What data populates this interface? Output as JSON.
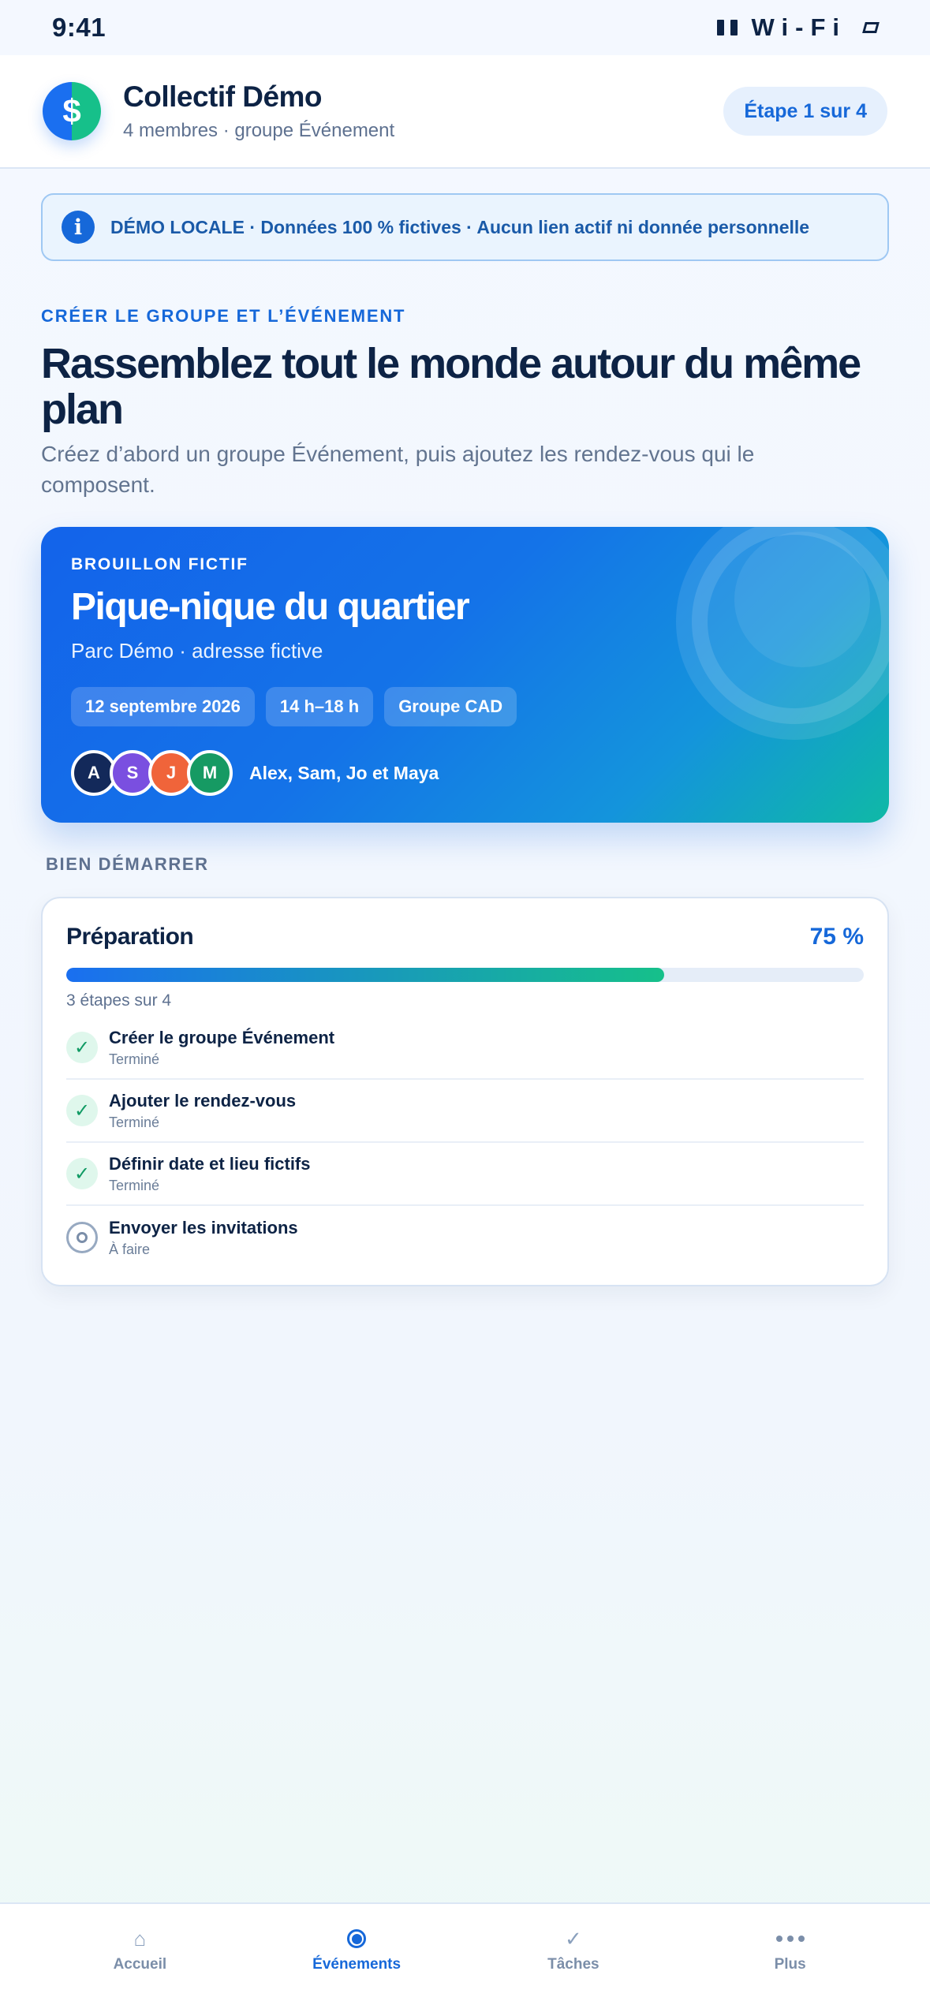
{
  "status_bar": {
    "time": "9:41",
    "network": "Wi-Fi",
    "signal_icon": "signal-bars-icon",
    "battery_icon": "battery-icon"
  },
  "header": {
    "logo_symbol": "$",
    "title": "Collectif Démo",
    "subtitle": "4 membres · groupe Événement",
    "step_label": "Étape 1 sur 4"
  },
  "banner": {
    "icon_symbol": "i",
    "text": "DÉMO LOCALE · Données 100 % fictives · Aucun lien actif ni donnée personnelle"
  },
  "intro": {
    "eyebrow": "CRÉER LE GROUPE ET L’ÉVÉNEMENT",
    "headline": "Rassemblez tout le monde autour du même plan",
    "description": "Créez d’abord un groupe Événement, puis ajoutez les rendez-vous qui le composent."
  },
  "event_card": {
    "eyebrow": "BROUILLON FICTIF",
    "title": "Pique-nique du quartier",
    "place": "Parc Démo · adresse fictive",
    "chips": [
      "12 septembre 2026",
      "14 h–18 h",
      "Groupe CAD"
    ],
    "avatars": [
      {
        "initial": "A",
        "color": "#13295a"
      },
      {
        "initial": "S",
        "color": "#7a4fe0"
      },
      {
        "initial": "J",
        "color": "#f0643a"
      },
      {
        "initial": "M",
        "color": "#169a63"
      }
    ],
    "participants": "Alex, Sam, Jo et Maya"
  },
  "section_title": "BIEN DÉMARRER",
  "preparation": {
    "title": "Préparation",
    "percent_label": "75 %",
    "progress": 0.75,
    "count_label": "3 étapes sur 4",
    "items": [
      {
        "title": "Créer le groupe Événement",
        "status": "Terminé",
        "done": true
      },
      {
        "title": "Ajouter le rendez-vous",
        "status": "Terminé",
        "done": true
      },
      {
        "title": "Définir date et lieu fictifs",
        "status": "Terminé",
        "done": true
      },
      {
        "title": "Envoyer les invitations",
        "status": "À faire",
        "done": false
      }
    ]
  },
  "tabs": [
    {
      "label": "Accueil",
      "icon": "home-icon",
      "active": false
    },
    {
      "label": "Événements",
      "icon": "radio-icon",
      "active": true
    },
    {
      "label": "Tâches",
      "icon": "check-icon",
      "active": false
    },
    {
      "label": "Plus",
      "icon": "more-icon",
      "active": false
    }
  ],
  "colors": {
    "accent": "#1668d9",
    "success": "#16c08a",
    "text": "#0d2345",
    "muted": "#5e7190"
  }
}
